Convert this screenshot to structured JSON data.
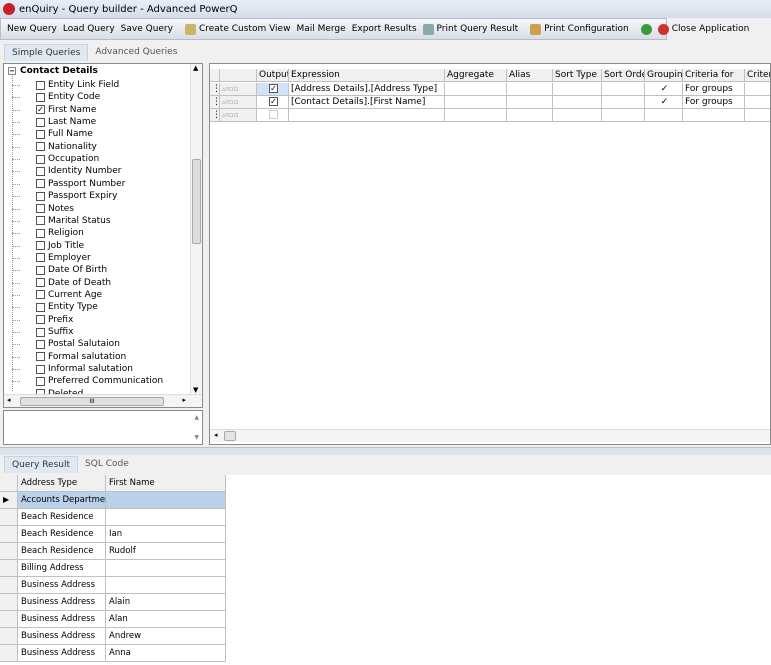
{
  "window": {
    "title": "enQuiry - Query builder - Advanced PowerQ"
  },
  "toolbar": {
    "items": [
      {
        "label": "New Query",
        "icon": ""
      },
      {
        "label": "Load Query",
        "icon": ""
      },
      {
        "label": "Save Query",
        "icon": ""
      },
      {
        "sep": true
      },
      {
        "label": "Create Custom View",
        "icon": "document-icon"
      },
      {
        "label": "Mail Merge",
        "icon": ""
      },
      {
        "label": "Export Results",
        "icon": ""
      },
      {
        "label": "Print Query Result",
        "icon": "printer-icon"
      },
      {
        "sep": true
      },
      {
        "label": "Print Configuration",
        "icon": "print-config-icon"
      },
      {
        "sep": true
      },
      {
        "label": "",
        "icon": "refresh-icon"
      },
      {
        "label": "Close Application",
        "icon": "close-circle-icon"
      }
    ]
  },
  "query_tabs": [
    {
      "label": "Simple Queries",
      "active": true
    },
    {
      "label": "Advanced Queries",
      "active": false
    }
  ],
  "tree": {
    "root": "Contact Details",
    "items": [
      {
        "label": "Entity Link Field",
        "checked": false
      },
      {
        "label": "Entity Code",
        "checked": false
      },
      {
        "label": "First Name",
        "checked": true
      },
      {
        "label": "Last Name",
        "checked": false
      },
      {
        "label": "Full Name",
        "checked": false
      },
      {
        "label": "Nationality",
        "checked": false
      },
      {
        "label": "Occupation",
        "checked": false
      },
      {
        "label": "Identity Number",
        "checked": false
      },
      {
        "label": "Passport Number",
        "checked": false
      },
      {
        "label": "Passport Expiry",
        "checked": false
      },
      {
        "label": "Notes",
        "checked": false
      },
      {
        "label": "Marital Status",
        "checked": false
      },
      {
        "label": "Religion",
        "checked": false
      },
      {
        "label": "Job Title",
        "checked": false
      },
      {
        "label": "Employer",
        "checked": false
      },
      {
        "label": "Date Of Birth",
        "checked": false
      },
      {
        "label": "Date of Death",
        "checked": false
      },
      {
        "label": "Current Age",
        "checked": false
      },
      {
        "label": "Entity Type",
        "checked": false
      },
      {
        "label": "Prefix",
        "checked": false
      },
      {
        "label": "Suffix",
        "checked": false
      },
      {
        "label": "Postal Salutaion",
        "checked": false
      },
      {
        "label": "Formal salutation",
        "checked": false
      },
      {
        "label": "Informal salutation",
        "checked": false
      },
      {
        "label": "Preferred Communication",
        "checked": false
      },
      {
        "label": "Deleted",
        "checked": false
      }
    ],
    "scroll_thumb_label": "III"
  },
  "query_grid": {
    "columns": [
      "Output",
      "Expression",
      "Aggregate",
      "Alias",
      "Sort Type",
      "Sort Order",
      "Grouping",
      "Criteria for",
      "Criteria"
    ],
    "rows": [
      {
        "output": true,
        "expression": "[Address Details].[Address Type]",
        "grouping": true,
        "criteria_for": "For groups"
      },
      {
        "output": true,
        "expression": "[Contact Details].[First Name]",
        "grouping": true,
        "criteria_for": "For groups"
      },
      {
        "output": false,
        "expression": "",
        "grouping": false,
        "criteria_for": ""
      }
    ]
  },
  "result_tabs": [
    {
      "label": "Query Result",
      "active": true
    },
    {
      "label": "SQL Code",
      "active": false
    }
  ],
  "result": {
    "columns": [
      "Address Type",
      "First Name"
    ],
    "rows": [
      [
        "Accounts Department",
        ""
      ],
      [
        "Beach Residence",
        ""
      ],
      [
        "Beach Residence",
        "Ian"
      ],
      [
        "Beach Residence",
        "Rudolf"
      ],
      [
        "Billing Address",
        ""
      ],
      [
        "Business Address",
        ""
      ],
      [
        "Business Address",
        "Alain"
      ],
      [
        "Business Address",
        "Alan"
      ],
      [
        "Business Address",
        "Andrew"
      ],
      [
        "Business Address",
        "Anna"
      ]
    ],
    "selected_row": 0,
    "selected_color": "#b9d1ea"
  }
}
